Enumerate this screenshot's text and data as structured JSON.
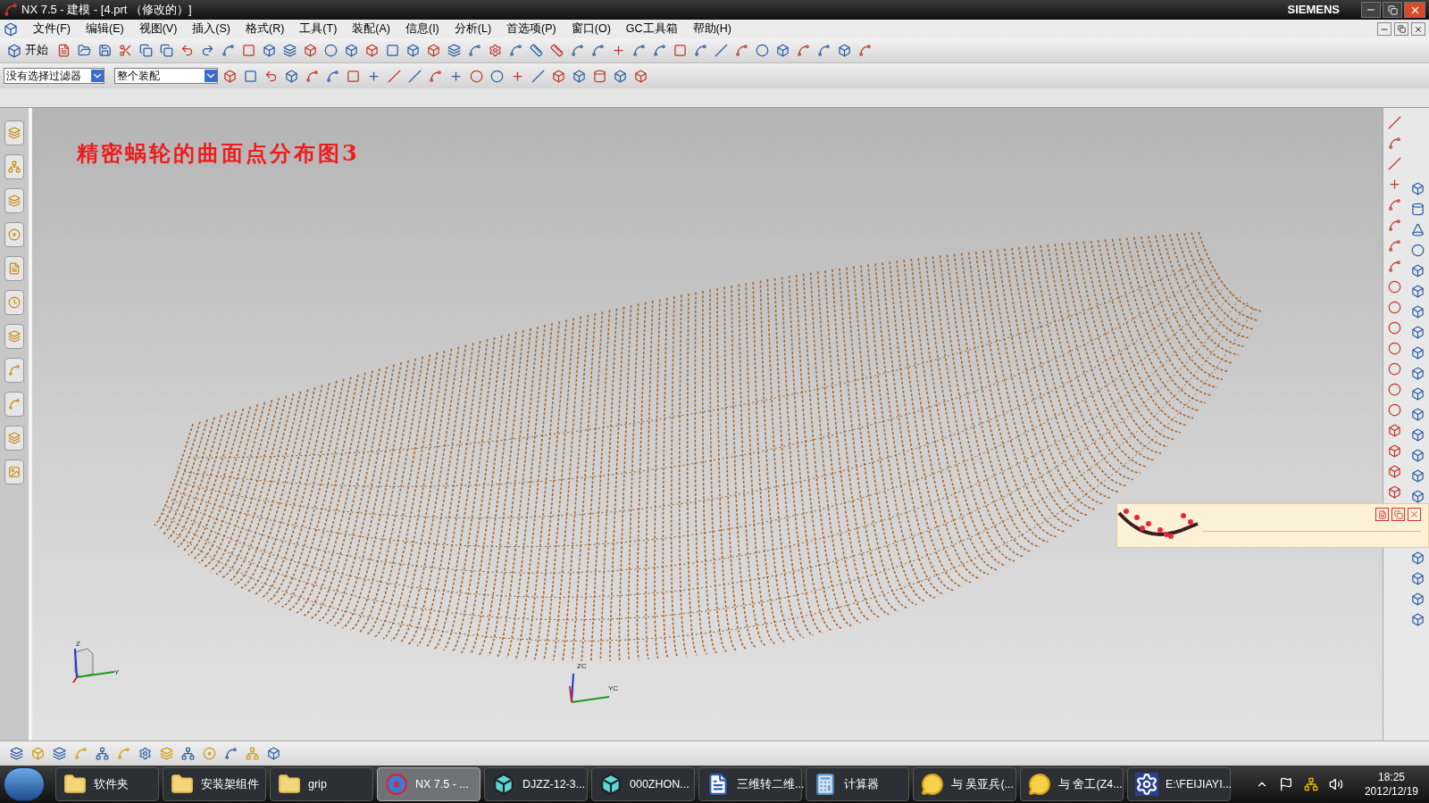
{
  "window": {
    "title": "NX 7.5 - 建模 - [4.prt （修改的）]",
    "brand": "SIEMENS"
  },
  "menu": [
    "文件(F)",
    "编辑(E)",
    "视图(V)",
    "插入(S)",
    "格式(R)",
    "工具(T)",
    "装配(A)",
    "信息(I)",
    "分析(L)",
    "首选项(P)",
    "窗口(O)",
    "GC工具箱",
    "帮助(H)"
  ],
  "toolbar": {
    "start_button": "开始"
  },
  "selection_bar": {
    "filter": "没有选择过滤器",
    "scope": "整个装配"
  },
  "viewport": {
    "title": "精密蜗轮的曲面点分布图3",
    "view_triad": {
      "z": "Z",
      "y": "Y"
    },
    "wcs": {
      "z": "ZC",
      "y": "YC"
    }
  },
  "taskbar": {
    "items": [
      {
        "label": "软件夹",
        "kind": "folder",
        "selected": false
      },
      {
        "label": "安装架组件",
        "kind": "folder",
        "selected": false
      },
      {
        "label": "grip",
        "kind": "folder",
        "selected": false
      },
      {
        "label": "NX 7.5 - ...",
        "kind": "nx",
        "selected": true
      },
      {
        "label": "DJZZ-12-3...",
        "kind": "part",
        "selected": false
      },
      {
        "label": "000ZHON...",
        "kind": "part",
        "selected": false
      },
      {
        "label": "三维转二维...",
        "kind": "word",
        "selected": false
      },
      {
        "label": "计算器",
        "kind": "calculator",
        "selected": false
      },
      {
        "label": "与 吴亚兵(...",
        "kind": "chat",
        "selected": false
      },
      {
        "label": "与 舍工(Z4...",
        "kind": "chat",
        "selected": false
      },
      {
        "label": "E:\\FEIJIAYI...",
        "kind": "app",
        "selected": false
      }
    ],
    "clock": {
      "time": "18:25",
      "date": "2012/12/19"
    }
  }
}
